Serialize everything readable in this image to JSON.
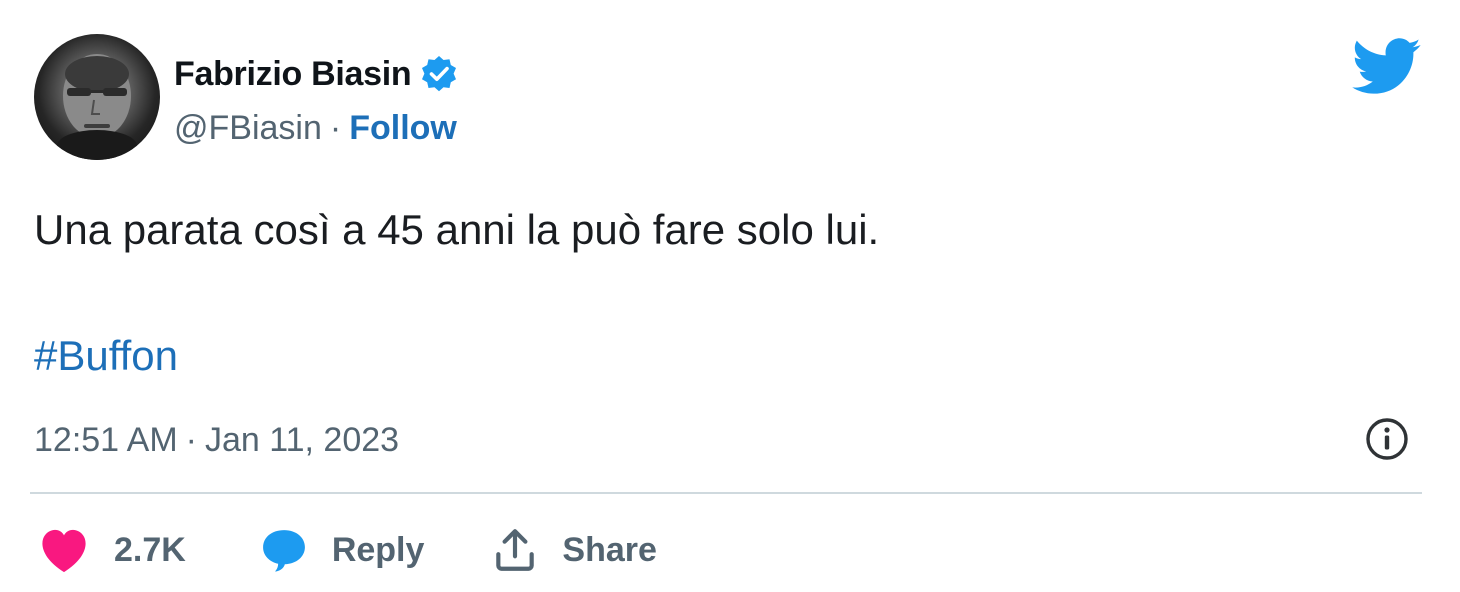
{
  "author": {
    "display_name": "Fabrizio Biasin",
    "handle": "@FBiasin",
    "separator": "·",
    "follow_label": "Follow",
    "verified": true
  },
  "tweet": {
    "text": "Una parata così a 45 anni la può fare solo lui.",
    "hashtag": "#Buffon",
    "time": "12:51 AM",
    "separator": "·",
    "date": "Jan 11, 2023"
  },
  "actions": {
    "like_count": "2.7K",
    "reply_label": "Reply",
    "share_label": "Share"
  },
  "icons": {
    "brand": "twitter-bird-icon",
    "verified": "verified-badge-icon",
    "info": "info-icon",
    "like": "heart-icon",
    "reply": "speech-bubble-icon",
    "share": "share-upload-icon"
  },
  "colors": {
    "brand_blue": "#1d9bf0",
    "link_blue": "#1d6fb8",
    "heart_pink": "#f91880",
    "text_primary": "#0f1419",
    "text_secondary": "#536471",
    "divider": "#cfd9de"
  }
}
